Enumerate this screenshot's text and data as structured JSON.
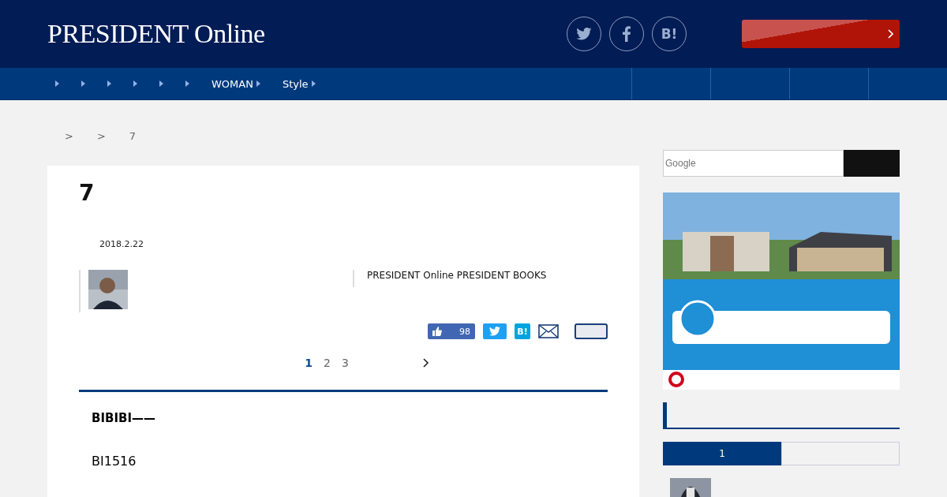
{
  "header": {
    "logo": "PRESIDENT Online",
    "social": [
      {
        "kind": "twitter"
      },
      {
        "kind": "facebook"
      },
      {
        "kind": "hatena",
        "label": "B!"
      }
    ]
  },
  "nav": {
    "items": [
      {
        "kind": "caret"
      },
      {
        "kind": "caret"
      },
      {
        "kind": "caret"
      },
      {
        "kind": "caret"
      },
      {
        "kind": "caret"
      },
      {
        "kind": "caret"
      },
      {
        "kind": "caret",
        "label": "WOMAN"
      },
      {
        "kind": "caret",
        "label": "Style"
      }
    ]
  },
  "breadcrumb": [
    ">",
    ">",
    "7"
  ],
  "article": {
    "title": "7",
    "date": "2018.2.22",
    "source": "PRESIDENT Online PRESIDENT BOOKS",
    "share": {
      "like_count": "98",
      "hatena": "B!"
    },
    "pages": [
      {
        "label": "1",
        "selected": true
      },
      {
        "label": "2",
        "selected": false
      },
      {
        "label": "3",
        "selected": false
      }
    ],
    "lead": "BIBIBI——",
    "body": "BI1516"
  },
  "sidebar": {
    "search": {
      "placeholder": "Google"
    },
    "tabs": [
      {
        "label": "1",
        "selected": true
      },
      {
        "selected": false
      }
    ]
  }
}
